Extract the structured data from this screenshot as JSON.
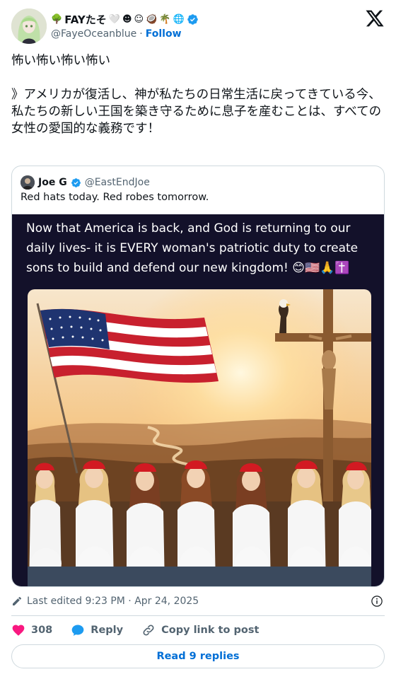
{
  "author": {
    "display_name": "FAYたそ",
    "name_emojis": [
      "🤍",
      "☻",
      "☺",
      "🥥",
      "🌴",
      "🌐"
    ],
    "handle": "@FayeOceanblue",
    "separator": "·",
    "follow_label": "Follow"
  },
  "tweet": {
    "line1": "怖い怖い怖い怖い",
    "line2": "》アメリカが復活し、神が私たちの日常生活に戻ってきている今、",
    "line3": "私たちの新しい王国を築き守るために息子を産むことは、すべての女性の愛国的な義務です！"
  },
  "quoted": {
    "display_name": "Joe G",
    "handle": "@EastEndJoe",
    "text": "Red hats today. Red robes tomorrow.",
    "image_text_line1": "Now that America is back, and God is returning to our",
    "image_text_line2": "daily lives- it is EVERY woman's patriotic duty to create",
    "image_text_line3": "sons to build and defend our new kingdom! 😊🇺🇸🙏✝️"
  },
  "meta": {
    "edited_label": "Last edited 9:23 PM · Apr 24, 2025"
  },
  "actions": {
    "like_count": "308",
    "reply_label": "Reply",
    "copy_label": "Copy link to post"
  },
  "read_replies_label": "Read 9 replies",
  "colors": {
    "link_blue": "#006fd6",
    "heart_red": "#f91880",
    "verified_blue": "#1d9bf0",
    "border": "#cfd9de",
    "secondary_text": "#536471"
  }
}
